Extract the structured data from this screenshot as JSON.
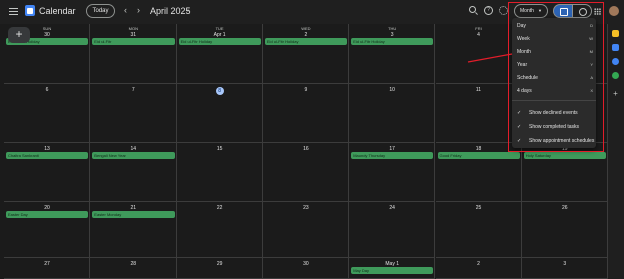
{
  "app": {
    "title": "Calendar"
  },
  "toolbar": {
    "today_label": "Today",
    "prev_icon": "chevron-left-icon",
    "next_icon": "chevron-right-icon",
    "prev_glyph": "‹",
    "next_glyph": "›",
    "month_title": "April 2025",
    "view_label": "Month",
    "help_glyph": "?"
  },
  "days_of_week": [
    "SUN",
    "MON",
    "TUE",
    "WED",
    "THU",
    "FRI",
    "SAT"
  ],
  "weeks": [
    {
      "dates": [
        "30",
        "31",
        "Apr 1",
        "2",
        "3",
        "4",
        "5"
      ]
    },
    {
      "dates": [
        "6",
        "7",
        "8",
        "9",
        "10",
        "11",
        "12"
      ]
    },
    {
      "dates": [
        "13",
        "14",
        "15",
        "16",
        "17",
        "18",
        "19"
      ]
    },
    {
      "dates": [
        "20",
        "21",
        "22",
        "23",
        "24",
        "25",
        "26"
      ]
    },
    {
      "dates": [
        "27",
        "28",
        "29",
        "30",
        "May 1",
        "2",
        "3"
      ]
    }
  ],
  "events": {
    "w0_sun": "Eid al-Fitr Holiday",
    "w0_mon": "Eid ul-Fitr",
    "w0_tue": "Eid ul-Fitr Holiday",
    "w0_wed": "Eid ul-Fitr Holiday",
    "w0_thu": "Eid ul-Fitr Holiday",
    "w2_sun": "Chaitra Sankranti",
    "w2_mon": "Bengali New Year",
    "w2_thu": "Maundy Thursday",
    "w2_fri": "Good Friday",
    "w2_sat": "Holy Saturday",
    "w3_sun": "Easter Day",
    "w3_mon": "Easter Monday",
    "w4_thu": "May Day"
  },
  "dropdown": {
    "items": [
      {
        "label": "Day",
        "key": "D"
      },
      {
        "label": "Week",
        "key": "W"
      },
      {
        "label": "Month",
        "key": "M"
      },
      {
        "label": "Year",
        "key": "Y"
      },
      {
        "label": "Schedule",
        "key": "A"
      },
      {
        "label": "4 days",
        "key": "X"
      }
    ],
    "checks": [
      {
        "label": "Show declined events"
      },
      {
        "label": "Show completed tasks"
      },
      {
        "label": "Show appointment schedules"
      }
    ],
    "check_glyph": "✓"
  },
  "colors": {
    "event_green": "#3f9a5b",
    "highlight_red": "#e21d2a",
    "today_blue": "#a8c7fa"
  }
}
